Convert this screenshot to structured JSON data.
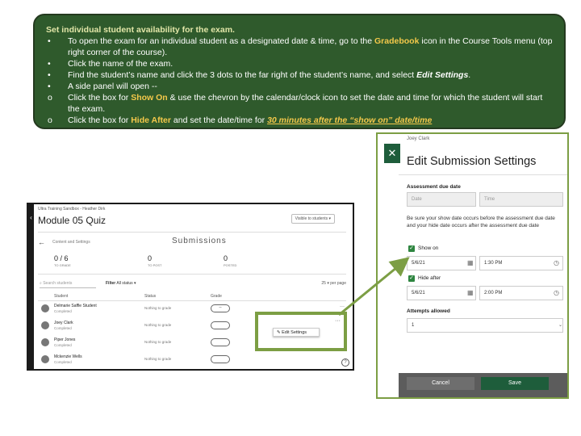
{
  "instructions": {
    "title": "Set individual student availability for the exam.",
    "items": [
      {
        "bullet": "•",
        "pre": "To open the exam for an individual student as a designated date & time, go to the ",
        "hl": "Gradebook",
        "post": " icon in the Course Tools menu (top right corner of the course)."
      },
      {
        "bullet": "•",
        "pre": "Click the name of the exam.",
        "hl": "",
        "post": ""
      },
      {
        "bullet": "•",
        "pre": "Find the student’s name and click the 3 dots to the far right of the student’s name, and select ",
        "em": "Edit Settings",
        "post": "."
      },
      {
        "bullet": "•",
        "pre": "A side panel will open --",
        "hl": "",
        "post": ""
      },
      {
        "bullet": "o",
        "pre": "Click the box for ",
        "hl": "Show On",
        "post": " & use the chevron by the calendar/clock icon to set the date and time for which the student will start the exam."
      },
      {
        "bullet": "o",
        "pre": "Click the box for ",
        "hl": "Hide After",
        "post": " and set the date/time for ",
        "ul": "30 minutes after the “show on” date/time"
      }
    ]
  },
  "left_screenshot": {
    "breadcrumb": "Ultra Training Sandbox - Heather Dirk",
    "title": "Module 05 Quiz",
    "visible_tag": "Visible to students",
    "back_label": "Content and Settings",
    "page_heading": "Submissions",
    "stats": [
      {
        "value": "0 / 6",
        "label": "TO GRADE"
      },
      {
        "value": "0",
        "label": "TO POST"
      },
      {
        "value": "0",
        "label": "POSTED"
      }
    ],
    "search_placeholder": "Search students",
    "filter_label": "Filter",
    "filter_value": "All status",
    "pager": "25 ▾ per page",
    "columns": [
      "Student",
      "Status",
      "Grade"
    ],
    "rows": [
      {
        "name": "Delmarie Saffle Student",
        "status": "Completed",
        "grade_status": "Nothing to grade",
        "grade": "--"
      },
      {
        "name": "Joey Clark",
        "status": "Completed",
        "grade_status": "Nothing to grade",
        "grade": ""
      },
      {
        "name": "Piper Jones",
        "status": "Completed",
        "grade_status": "Nothing to grade",
        "grade": ""
      },
      {
        "name": "Mckenzie Wells",
        "status": "Completed",
        "grade_status": "Nothing to grade",
        "grade": ""
      }
    ]
  },
  "callout": {
    "menu_item": "Edit Settings"
  },
  "right_screenshot": {
    "student": "Joey Clark",
    "heading": "Edit Submission Settings",
    "due_section": "Assessment due date",
    "date_placeholder": "Date",
    "time_placeholder": "Time",
    "note": "Be sure your show date occurs before the assessment due date and your hide date occurs after the assessment due date",
    "show_on_label": "Show on",
    "show_on_date": "5/6/21",
    "show_on_time": "1:30 PM",
    "hide_after_label": "Hide after",
    "hide_after_date": "5/6/21",
    "hide_after_time": "2:00 PM",
    "attempts_label": "Attempts allowed",
    "attempts_value": "1",
    "cancel_label": "Cancel",
    "save_label": "Save"
  },
  "colors": {
    "instruction_bg": "#2f5a2c",
    "highlight": "#f3c84a",
    "callout_green": "#7c9e44",
    "save_bg": "#1e5d3b"
  }
}
